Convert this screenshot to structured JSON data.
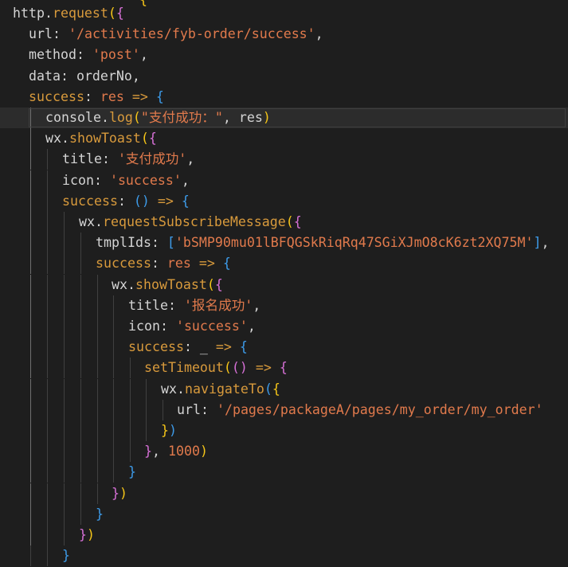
{
  "editor": {
    "language": "javascript",
    "colors": {
      "background": "#1e1e1e",
      "identifier": "#d4d4d4",
      "function": "#d89a3c",
      "string": "#e17a4c",
      "bracket_level1": "#f5c518",
      "bracket_level2": "#d670d6",
      "bracket_level3": "#3d9be9",
      "current_line": "#2c2c2c"
    },
    "lines": [
      {
        "tokens": [
          [
            "t-id",
            "http"
          ],
          [
            "t-punc",
            "."
          ],
          [
            "t-fn",
            "request"
          ],
          [
            "t-br1",
            "("
          ],
          [
            "t-br2",
            "{"
          ]
        ]
      },
      {
        "tokens": [
          [
            "t-key",
            "url"
          ],
          [
            "t-punc",
            ": "
          ],
          [
            "t-str",
            "'/activities/fyb-order/success'"
          ],
          [
            "t-punc",
            ","
          ]
        ]
      },
      {
        "tokens": [
          [
            "t-key",
            "method"
          ],
          [
            "t-punc",
            ": "
          ],
          [
            "t-str",
            "'post'"
          ],
          [
            "t-punc",
            ","
          ]
        ]
      },
      {
        "tokens": [
          [
            "t-key",
            "data"
          ],
          [
            "t-punc",
            ": "
          ],
          [
            "t-id",
            "orderNo"
          ],
          [
            "t-punc",
            ","
          ]
        ]
      },
      {
        "tokens": [
          [
            "t-fn",
            "success"
          ],
          [
            "t-punc",
            ": "
          ],
          [
            "t-param",
            "res"
          ],
          [
            "t-punc",
            " "
          ],
          [
            "t-arrow",
            "=>"
          ],
          [
            "t-punc",
            " "
          ],
          [
            "t-br3",
            "{"
          ]
        ]
      },
      {
        "tokens": [
          [
            "t-id",
            "console"
          ],
          [
            "t-punc",
            "."
          ],
          [
            "t-fn",
            "log"
          ],
          [
            "t-br1",
            "("
          ],
          [
            "t-str",
            "\"支付成功：\""
          ],
          [
            "t-punc",
            ", "
          ],
          [
            "t-id",
            "res"
          ],
          [
            "t-br1",
            ")"
          ]
        ]
      },
      {
        "tokens": [
          [
            "t-id",
            "wx"
          ],
          [
            "t-punc",
            "."
          ],
          [
            "t-fn",
            "showToast"
          ],
          [
            "t-br1",
            "("
          ],
          [
            "t-br2",
            "{"
          ]
        ]
      },
      {
        "tokens": [
          [
            "t-key",
            "title"
          ],
          [
            "t-punc",
            ": "
          ],
          [
            "t-str",
            "'支付成功'"
          ],
          [
            "t-punc",
            ","
          ]
        ]
      },
      {
        "tokens": [
          [
            "t-key",
            "icon"
          ],
          [
            "t-punc",
            ": "
          ],
          [
            "t-str",
            "'success'"
          ],
          [
            "t-punc",
            ","
          ]
        ]
      },
      {
        "tokens": [
          [
            "t-fn",
            "success"
          ],
          [
            "t-punc",
            ": "
          ],
          [
            "t-br3",
            "()"
          ],
          [
            "t-punc",
            " "
          ],
          [
            "t-arrow",
            "=>"
          ],
          [
            "t-punc",
            " "
          ],
          [
            "t-br3",
            "{"
          ]
        ]
      },
      {
        "tokens": [
          [
            "t-id",
            "wx"
          ],
          [
            "t-punc",
            "."
          ],
          [
            "t-fn",
            "requestSubscribeMessage"
          ],
          [
            "t-br1",
            "("
          ],
          [
            "t-br2",
            "{"
          ]
        ]
      },
      {
        "tokens": [
          [
            "t-key",
            "tmplIds"
          ],
          [
            "t-punc",
            ": "
          ],
          [
            "t-br3",
            "["
          ],
          [
            "t-str",
            "'bSMP90mu01lBFQGSkRiqRq47SGiXJmO8cK6zt2XQ75M'"
          ],
          [
            "t-br3",
            "]"
          ],
          [
            "t-punc",
            ","
          ]
        ]
      },
      {
        "tokens": [
          [
            "t-fn",
            "success"
          ],
          [
            "t-punc",
            ": "
          ],
          [
            "t-param",
            "res"
          ],
          [
            "t-punc",
            " "
          ],
          [
            "t-arrow",
            "=>"
          ],
          [
            "t-punc",
            " "
          ],
          [
            "t-br3",
            "{"
          ]
        ]
      },
      {
        "tokens": [
          [
            "t-id",
            "wx"
          ],
          [
            "t-punc",
            "."
          ],
          [
            "t-fn",
            "showToast"
          ],
          [
            "t-br1",
            "("
          ],
          [
            "t-br2",
            "{"
          ]
        ]
      },
      {
        "tokens": [
          [
            "t-key",
            "title"
          ],
          [
            "t-punc",
            ": "
          ],
          [
            "t-str",
            "'报名成功'"
          ],
          [
            "t-punc",
            ","
          ]
        ]
      },
      {
        "tokens": [
          [
            "t-key",
            "icon"
          ],
          [
            "t-punc",
            ": "
          ],
          [
            "t-str",
            "'success'"
          ],
          [
            "t-punc",
            ","
          ]
        ]
      },
      {
        "tokens": [
          [
            "t-fn",
            "success"
          ],
          [
            "t-punc",
            ": "
          ],
          [
            "t-id",
            "_"
          ],
          [
            "t-punc",
            " "
          ],
          [
            "t-arrow",
            "=>"
          ],
          [
            "t-punc",
            " "
          ],
          [
            "t-br3",
            "{"
          ]
        ]
      },
      {
        "tokens": [
          [
            "t-fn",
            "setTimeout"
          ],
          [
            "t-br1",
            "("
          ],
          [
            "t-br2",
            "()"
          ],
          [
            "t-punc",
            " "
          ],
          [
            "t-arrow",
            "=>"
          ],
          [
            "t-punc",
            " "
          ],
          [
            "t-br2",
            "{"
          ]
        ]
      },
      {
        "tokens": [
          [
            "t-id",
            "wx"
          ],
          [
            "t-punc",
            "."
          ],
          [
            "t-fn",
            "navigateTo"
          ],
          [
            "t-br3",
            "("
          ],
          [
            "t-br1",
            "{"
          ]
        ]
      },
      {
        "tokens": [
          [
            "t-key",
            "url"
          ],
          [
            "t-punc",
            ": "
          ],
          [
            "t-str",
            "'/pages/packageA/pages/my_order/my_order'"
          ]
        ]
      },
      {
        "tokens": [
          [
            "t-br1",
            "}"
          ],
          [
            "t-br3",
            ")"
          ]
        ]
      },
      {
        "tokens": [
          [
            "t-br2",
            "}"
          ],
          [
            "t-punc",
            ", "
          ],
          [
            "t-num",
            "1000"
          ],
          [
            "t-br1",
            ")"
          ]
        ]
      },
      {
        "tokens": [
          [
            "t-br3",
            "}"
          ]
        ]
      },
      {
        "tokens": [
          [
            "t-br2",
            "}"
          ],
          [
            "t-br1",
            ")"
          ]
        ]
      },
      {
        "tokens": [
          [
            "t-br3",
            "}"
          ]
        ]
      },
      {
        "tokens": [
          [
            "t-br2",
            "}"
          ],
          [
            "t-br1",
            ")"
          ]
        ]
      },
      {
        "tokens": [
          [
            "t-br3",
            "}"
          ]
        ]
      }
    ]
  }
}
